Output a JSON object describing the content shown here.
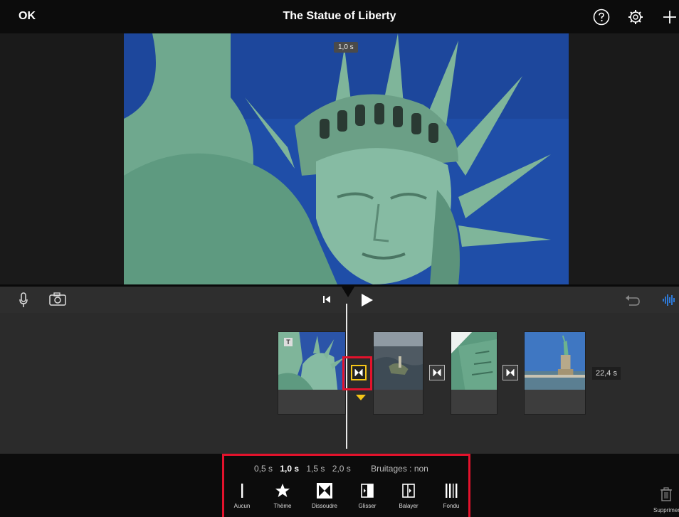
{
  "topbar": {
    "ok_label": "OK",
    "title": "The Statue of Liberty",
    "icons": [
      "help-icon",
      "settings-icon",
      "add-icon"
    ]
  },
  "preview": {
    "time_badge": "1,0 s",
    "image": "statue-of-liberty-closeup"
  },
  "controls": {
    "icons": [
      "microphone-icon",
      "camera-icon",
      "skip-to-start-icon",
      "play-icon",
      "undo-icon",
      "audio-waveform-icon"
    ]
  },
  "timeline": {
    "clips": [
      {
        "image": "statue-torch-arm",
        "badge": "T"
      },
      {
        "image": "liberty-island-aerial"
      },
      {
        "image": "statue-tablet-closeup"
      },
      {
        "image": "statue-full-pedestal"
      }
    ],
    "transitions": [
      "dissolve",
      "dissolve",
      "dissolve"
    ],
    "duration_label": "22,4 s"
  },
  "transition_panel": {
    "durations": [
      "0,5 s",
      "1,0 s",
      "1,5 s",
      "2,0 s"
    ],
    "selected_duration": "1,0 s",
    "sound_effects": "Bruitages : non",
    "types": [
      {
        "label": "Aucun",
        "icon": "none-icon"
      },
      {
        "label": "Thème",
        "icon": "star-icon"
      },
      {
        "label": "Dissoudre",
        "icon": "dissolve-icon"
      },
      {
        "label": "Glisser",
        "icon": "slide-icon"
      },
      {
        "label": "Balayer",
        "icon": "wipe-icon"
      },
      {
        "label": "Fondu",
        "icon": "fade-icon"
      }
    ],
    "selected_type": "Dissoudre"
  },
  "delete_label": "Supprimer",
  "colors": {
    "selection": "#f5c518",
    "annotation": "#e3122c",
    "accent": "#2f8cff"
  }
}
